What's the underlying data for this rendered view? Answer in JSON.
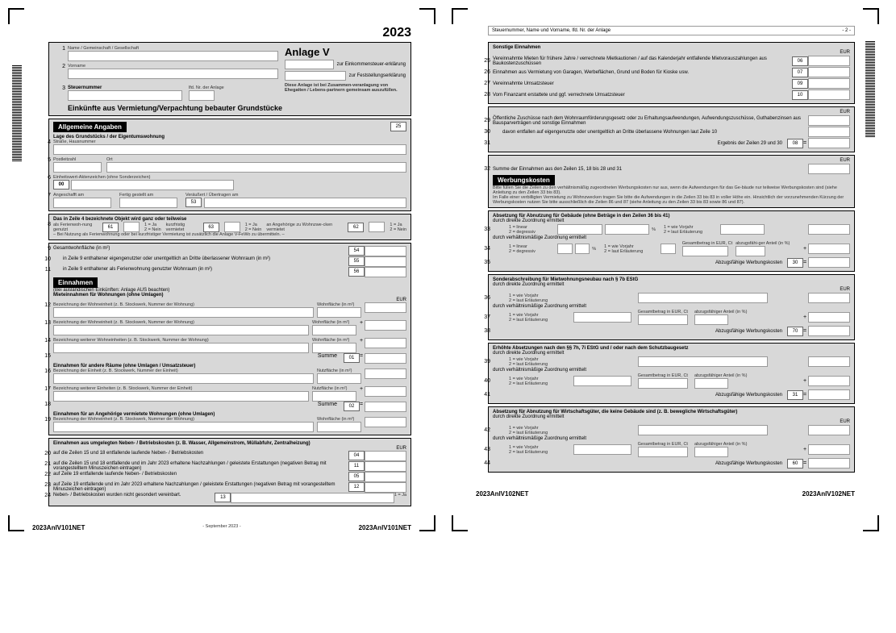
{
  "year": "2023",
  "title": "Anlage V",
  "subtitle1": "zur Einkommensteuer-erklärung",
  "subtitle2": "zur Feststellungserklärung",
  "note": "Diese Anlage ist bei Zusammen-veranlagung von Ehegatten / Lebens-partnern gemeinsam auszufüllen.",
  "lbl_name": "Name / Gemeinschaft / Gesellschaft",
  "lbl_vorname": "Vorname",
  "lbl_stnr": "Steuernummer",
  "lbl_lfd": "lfd. Nr. der Anlage",
  "main_heading": "Einkünfte aus Vermietung/Verpachtung bebauter Grundstücke",
  "sec_allg": "Allgemeine Angaben",
  "lage": "Lage des Grundstücks / der Eigentumswohnung",
  "lage_sub": "Straße, Hausnummer",
  "plz": "Postleitzahl",
  "ort": "Ort",
  "ewaz": "Einheitswert-Aktenzeichen (ohne Sonderzeichen)",
  "ewaz_val": "00",
  "angeschafft": "Angeschafft am",
  "fertig": "Fertig gestellt am",
  "verau": "Veräußert / Übertragen am",
  "box53": "53",
  "z4_head": "Das in Zeile 4 bezeichnete Objekt wird ganz oder teilweise",
  "ferien": "als Ferienwoh-nung genutzt",
  "kurz": "kurzfristig vermietet",
  "ange": "an Angehörige zu Wohnzwe-cken vermietet",
  "ja_nein": "1 = Ja\n2 = Nein",
  "n61": "61",
  "n63": "63",
  "n62": "62",
  "fewo_note": "– Bei Nutzung als Ferienwohnung oder bei kurzfristiger Vermietung ist zusätzlich die Anlage V-FeWo zu übermitteln. –",
  "gesamt": "Gesamtwohnfläche (in m²)",
  "z10": "in Zeile 9 enthaltener eigengenutzter oder unentgeltlich an Dritte überlassener Wohnraum (in m²)",
  "z11": "in Zeile 9 enthaltener als Ferienwohnung genutzter Wohnraum (in m²)",
  "n54": "54",
  "n55": "55",
  "n56": "56",
  "sec_einn": "Einnahmen",
  "aus_note": "(Bei ausländischen Einkünften: Anlage AUS beachten)",
  "miet_w": "Mieteinnahmen für Wohnungen (ohne Umlagen)",
  "bez_w": "Bezeichnung der Wohneinheit (z. B. Stockwerk, Nummer der Wohnung)",
  "bez_w2": "Bezeichnung weiterer Wohneinheiten (z. B. Stockwerk, Nummer der Wohnung)",
  "wohnfl": "Wohnfläche (in m²)",
  "summe": "Summe",
  "n01": "01",
  "n02": "02",
  "einn_r": "Einnahmen für andere Räume (ohne Umlagen / Umsatzsteuer)",
  "bez_e": "Bezeichnung der Einheit (z. B. Stockwerk, Nummer der Einheit)",
  "bez_e2": "Bezeichnung weiterer Einheiten (z. B. Stockwerk, Nummer der Einheit)",
  "nutzfl": "Nutzfläche (in m²)",
  "einn_a": "Einnahmen für an Angehörige vermietete Wohnungen (ohne Umlagen)",
  "umlag": "Einnahmen aus umgelegten Neben- / Betriebskosten (z. B. Wasser, Allgemeinstrom, Müllabfuhr, Zentralheizung)",
  "z20": "auf die Zeilen 15 und 18 entfallende laufende Neben- / Betriebskosten",
  "z21": "auf die Zeilen 15 und 18 entfallende und im Jahr 2023 erhaltene Nachzahlungen / geleistete Erstattungen (negativen Betrag mit vorangestelltem Minuszeichen eintragen)",
  "z22": "auf Zeile 19 entfallende laufende Neben- / Betriebskosten",
  "z23": "auf Zeile 19 entfallende und im Jahr 2023 erhaltene Nachzahlungen / geleistete Erstattungen (negativen Betrag mit vorangestelltem Minuszeichen eintragen)",
  "z24": "Neben- / Betriebskosten wurden nicht gesondert vereinbart.",
  "n04": "04",
  "n11": "11",
  "n05": "05",
  "n12": "12",
  "n13": "13",
  "ja1": "1 = Ja",
  "foot1": "2023AnlV101NET",
  "foot_date": "- September 2023 -",
  "p2_hdr": "Steuernummer, Name und Vorname, lfd. Nr. der Anlage",
  "p2_num": "- 2 -",
  "sonst": "Sonstige Einnahmen",
  "z25": "Vereinnahmte Mieten für frühere Jahre / verrechnete Mietkautionen / auf das Kalenderjahr entfallende Mietvorauszahlungen aus Baukostenzuschüssen",
  "z26": "Einnahmen aus Vermietung von Garagen, Werbeflächen, Grund und Boden für Kioske usw.",
  "z27": "Vereinnahmte Umsatzsteuer",
  "z28": "Vom Finanzamt erstattete und ggf. verrechnete Umsatzsteuer",
  "z29": "Öffentliche Zuschüsse nach dem Wohnraumförderungsgesetz oder zu Erhaltungsaufwendungen, Aufwendungszuschüsse, Guthabenzinsen aus Bausparverträgen und sonstige Einnahmen",
  "z30": "davon entfallen auf eigengenutzte oder unentgeltlich an Dritte überlassene Wohnungen laut Zeile 10",
  "erg29": "Ergebnis der Zeilen 29 und 30",
  "z32": "Summe der Einnahmen aus den Zeilen 15, 18 bis 28 und 31",
  "n06": "06",
  "n07": "07",
  "n09": "09",
  "n10": "10",
  "n08": "08",
  "sec_werb": "Werbungskosten",
  "werb_note": "Bitte füllen Sie die Zeilen zu den verhältnismäßig zugeordneten Werbungskosten nur aus, wenn die Aufwendungen für das Ge-bäude nur teilweise Werbungskosten sind (siehe Anleitung zu den Zeilen 33 bis 83).\nIm Falle einer verbilligten Vermietung zu Wohnzwecken tragen Sie bitte die Aufwendungen in die Zeilen 33 bis 83 in voller Höhe ein. Hinsichtlich der vorzunehmenden Kürzung der Werbungskosten nutzen Sie bitte ausschließlich die Zeilen 86 und 87 (siehe Anleitung zu den Zeilen 33 bis 83 sowie 86 und 87).",
  "abs_geb": "Absetzung für Abnutzung für Gebäude (ohne Beträge in den Zeilen 36 bis 41)",
  "direkt": "durch direkte Zuordnung ermittelt",
  "verh": "durch verhältnismäßige Zuordnung ermittelt",
  "linear": "1 = linear\n2 = degressiv",
  "vorjahr": "1 = wie Vorjahr\n2 = laut Erläuterung",
  "proz": "%",
  "gesamt_eur": "Gesamtbetrag in EUR, Ct",
  "abz_ant": "abzugsfähi-ger Anteil (in %)",
  "abz_ant2": "abzugsfähiger Anteil (in %)",
  "abz_wk": "Abzugsfähige Werbungskosten",
  "n30": "30",
  "n70": "70",
  "n31": "31",
  "n60": "60",
  "sonder": "Sonderabschreibung für Mietwohnungsneubau nach § 7b EStG",
  "erhoht": "Erhöhte Absetzungen nach den §§ 7h, 7i EStG und / oder nach dem Schutzbaugesetz",
  "abs_wirt": "Absetzung für Abnutzung für Wirtschaftsgüter, die keine Gebäude sind (z. B. bewegliche Wirtschaftsgüter)",
  "foot2": "2023AnlV102NET",
  "n25": "25",
  "eur_lbl": "EUR"
}
